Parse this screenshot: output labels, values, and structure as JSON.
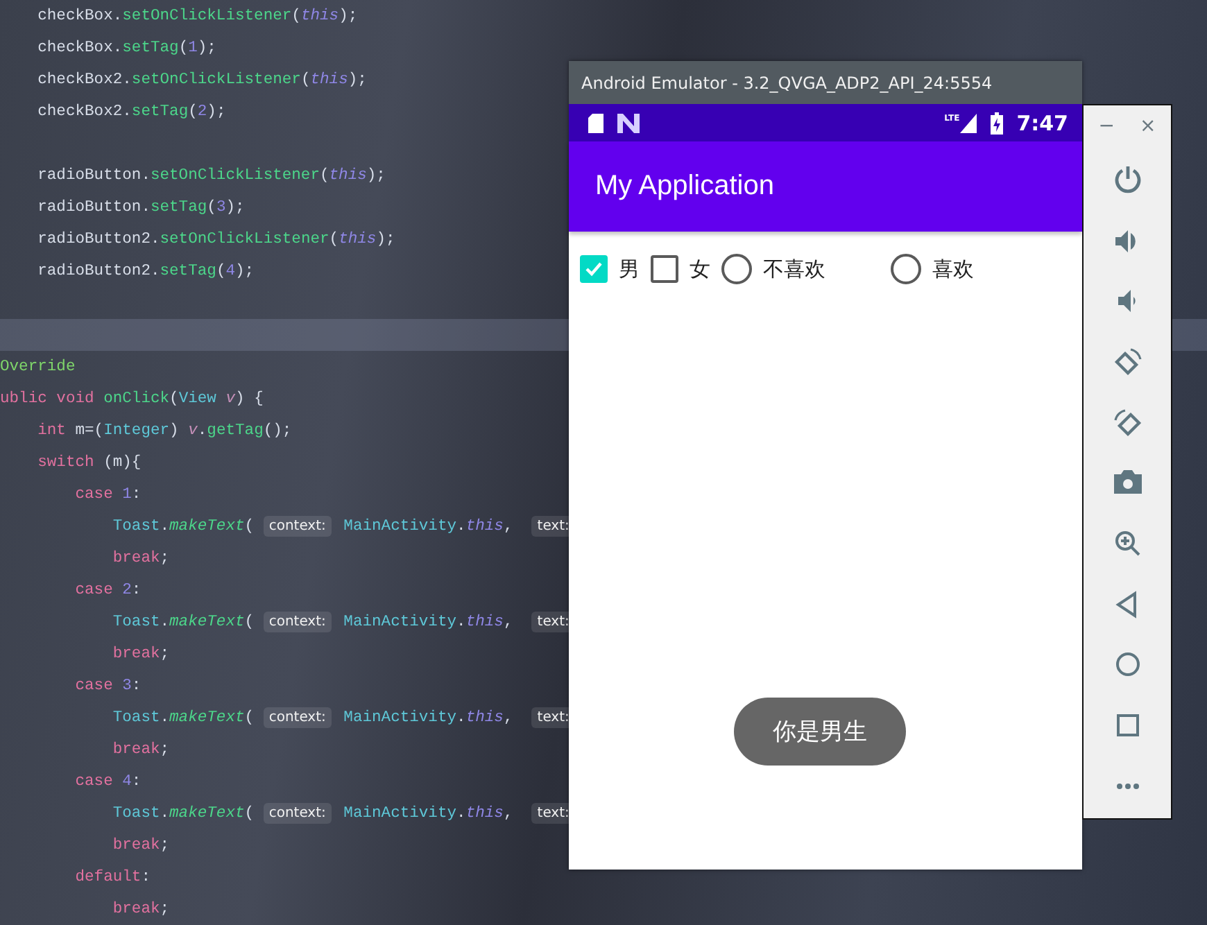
{
  "editor": {
    "lines": [
      {
        "current": false,
        "tokens": [
          {
            "kind": "plain",
            "t": "    checkBox."
          },
          {
            "kind": "method",
            "t": "setOnClickListener"
          },
          {
            "kind": "plain",
            "t": "("
          },
          {
            "kind": "self",
            "t": "this"
          },
          {
            "kind": "plain",
            "t": ");"
          }
        ]
      },
      {
        "current": false,
        "tokens": [
          {
            "kind": "plain",
            "t": "    checkBox."
          },
          {
            "kind": "method",
            "t": "setTag"
          },
          {
            "kind": "plain",
            "t": "("
          },
          {
            "kind": "number",
            "t": "1"
          },
          {
            "kind": "plain",
            "t": ");"
          }
        ]
      },
      {
        "current": false,
        "tokens": [
          {
            "kind": "plain",
            "t": "    checkBox2."
          },
          {
            "kind": "method",
            "t": "setOnClickListener"
          },
          {
            "kind": "plain",
            "t": "("
          },
          {
            "kind": "self",
            "t": "this"
          },
          {
            "kind": "plain",
            "t": ");"
          }
        ]
      },
      {
        "current": false,
        "tokens": [
          {
            "kind": "plain",
            "t": "    checkBox2."
          },
          {
            "kind": "method",
            "t": "setTag"
          },
          {
            "kind": "plain",
            "t": "("
          },
          {
            "kind": "number",
            "t": "2"
          },
          {
            "kind": "plain",
            "t": ");"
          }
        ]
      },
      {
        "current": false
      },
      {
        "current": false,
        "tokens": [
          {
            "kind": "plain",
            "t": "    radioButton."
          },
          {
            "kind": "method",
            "t": "setOnClickListener"
          },
          {
            "kind": "plain",
            "t": "("
          },
          {
            "kind": "self",
            "t": "this"
          },
          {
            "kind": "plain",
            "t": ");"
          }
        ]
      },
      {
        "current": false,
        "tokens": [
          {
            "kind": "plain",
            "t": "    radioButton."
          },
          {
            "kind": "method",
            "t": "setTag"
          },
          {
            "kind": "plain",
            "t": "("
          },
          {
            "kind": "number",
            "t": "3"
          },
          {
            "kind": "plain",
            "t": ");"
          }
        ]
      },
      {
        "current": false,
        "tokens": [
          {
            "kind": "plain",
            "t": "    radioButton2."
          },
          {
            "kind": "method",
            "t": "setOnClickListener"
          },
          {
            "kind": "plain",
            "t": "("
          },
          {
            "kind": "self",
            "t": "this"
          },
          {
            "kind": "plain",
            "t": ");"
          }
        ]
      },
      {
        "current": false,
        "tokens": [
          {
            "kind": "plain",
            "t": "    radioButton2."
          },
          {
            "kind": "method",
            "t": "setTag"
          },
          {
            "kind": "plain",
            "t": "("
          },
          {
            "kind": "number",
            "t": "4"
          },
          {
            "kind": "plain",
            "t": ");"
          }
        ]
      },
      {
        "current": false
      },
      {
        "current": true
      },
      {
        "current": false,
        "tokens": [
          {
            "kind": "annotation",
            "t": "Override"
          }
        ]
      },
      {
        "current": false,
        "tokens": [
          {
            "kind": "keyword",
            "t": "ublic void "
          },
          {
            "kind": "method",
            "t": "onClick"
          },
          {
            "kind": "plain",
            "t": "("
          },
          {
            "kind": "type",
            "t": "View "
          },
          {
            "kind": "param",
            "t": "v"
          },
          {
            "kind": "plain",
            "t": ") {"
          }
        ]
      },
      {
        "current": false,
        "tokens": [
          {
            "kind": "keyword",
            "t": "    int "
          },
          {
            "kind": "plain",
            "t": "m=("
          },
          {
            "kind": "type",
            "t": "Integer"
          },
          {
            "kind": "plain",
            "t": ") "
          },
          {
            "kind": "param",
            "t": "v"
          },
          {
            "kind": "plain",
            "t": "."
          },
          {
            "kind": "method",
            "t": "getTag"
          },
          {
            "kind": "plain",
            "t": "();"
          }
        ]
      },
      {
        "current": false,
        "tokens": [
          {
            "kind": "keyword",
            "t": "    switch "
          },
          {
            "kind": "plain",
            "t": "(m){"
          }
        ]
      },
      {
        "current": false,
        "tokens": [
          {
            "kind": "keyword",
            "t": "        case "
          },
          {
            "kind": "number",
            "t": "1"
          },
          {
            "kind": "plain",
            "t": ":"
          }
        ]
      },
      {
        "current": false,
        "tokens": [
          {
            "kind": "type",
            "t": "            Toast"
          },
          {
            "kind": "plain",
            "t": "."
          },
          {
            "kind": "static",
            "t": "makeText"
          },
          {
            "kind": "plain",
            "t": "( "
          },
          {
            "kind": "hint",
            "t": "context:"
          },
          {
            "kind": "type",
            "t": " MainActivity"
          },
          {
            "kind": "plain",
            "t": "."
          },
          {
            "kind": "self",
            "t": "this"
          },
          {
            "kind": "plain",
            "t": ",  "
          },
          {
            "kind": "hint",
            "t": "text:"
          }
        ]
      },
      {
        "current": false,
        "tokens": [
          {
            "kind": "keyword",
            "t": "            break"
          },
          {
            "kind": "plain",
            "t": ";"
          }
        ]
      },
      {
        "current": false,
        "tokens": [
          {
            "kind": "keyword",
            "t": "        case "
          },
          {
            "kind": "number",
            "t": "2"
          },
          {
            "kind": "plain",
            "t": ":"
          }
        ]
      },
      {
        "current": false,
        "tokens": [
          {
            "kind": "type",
            "t": "            Toast"
          },
          {
            "kind": "plain",
            "t": "."
          },
          {
            "kind": "static",
            "t": "makeText"
          },
          {
            "kind": "plain",
            "t": "( "
          },
          {
            "kind": "hint",
            "t": "context:"
          },
          {
            "kind": "type",
            "t": " MainActivity"
          },
          {
            "kind": "plain",
            "t": "."
          },
          {
            "kind": "self",
            "t": "this"
          },
          {
            "kind": "plain",
            "t": ",  "
          },
          {
            "kind": "hint",
            "t": "text:"
          }
        ]
      },
      {
        "current": false,
        "tokens": [
          {
            "kind": "keyword",
            "t": "            break"
          },
          {
            "kind": "plain",
            "t": ";"
          }
        ]
      },
      {
        "current": false,
        "tokens": [
          {
            "kind": "keyword",
            "t": "        case "
          },
          {
            "kind": "number",
            "t": "3"
          },
          {
            "kind": "plain",
            "t": ":"
          }
        ]
      },
      {
        "current": false,
        "tokens": [
          {
            "kind": "type",
            "t": "            Toast"
          },
          {
            "kind": "plain",
            "t": "."
          },
          {
            "kind": "static",
            "t": "makeText"
          },
          {
            "kind": "plain",
            "t": "( "
          },
          {
            "kind": "hint",
            "t": "context:"
          },
          {
            "kind": "type",
            "t": " MainActivity"
          },
          {
            "kind": "plain",
            "t": "."
          },
          {
            "kind": "self",
            "t": "this"
          },
          {
            "kind": "plain",
            "t": ",  "
          },
          {
            "kind": "hint",
            "t": "text:"
          }
        ]
      },
      {
        "current": false,
        "tokens": [
          {
            "kind": "keyword",
            "t": "            break"
          },
          {
            "kind": "plain",
            "t": ";"
          }
        ]
      },
      {
        "current": false,
        "tokens": [
          {
            "kind": "keyword",
            "t": "        case "
          },
          {
            "kind": "number",
            "t": "4"
          },
          {
            "kind": "plain",
            "t": ":"
          }
        ]
      },
      {
        "current": false,
        "tokens": [
          {
            "kind": "type",
            "t": "            Toast"
          },
          {
            "kind": "plain",
            "t": "."
          },
          {
            "kind": "static",
            "t": "makeText"
          },
          {
            "kind": "plain",
            "t": "( "
          },
          {
            "kind": "hint",
            "t": "context:"
          },
          {
            "kind": "type",
            "t": " MainActivity"
          },
          {
            "kind": "plain",
            "t": "."
          },
          {
            "kind": "self",
            "t": "this"
          },
          {
            "kind": "plain",
            "t": ",  "
          },
          {
            "kind": "hint",
            "t": "text:"
          }
        ]
      },
      {
        "current": false,
        "tokens": [
          {
            "kind": "keyword",
            "t": "            break"
          },
          {
            "kind": "plain",
            "t": ";"
          }
        ]
      },
      {
        "current": false,
        "tokens": [
          {
            "kind": "keyword",
            "t": "        default"
          },
          {
            "kind": "plain",
            "t": ":"
          }
        ]
      },
      {
        "current": false,
        "tokens": [
          {
            "kind": "keyword",
            "t": "            break"
          },
          {
            "kind": "plain",
            "t": ";"
          }
        ]
      }
    ]
  },
  "emulator": {
    "title": "Android Emulator - 3.2_QVGA_ADP2_API_24:5554",
    "status_bar": {
      "network_label": "LTE",
      "time": "7:47"
    },
    "app_bar": {
      "title": "My Application"
    },
    "options": [
      {
        "kind": "checkbox",
        "label": "男",
        "checked": true
      },
      {
        "kind": "checkbox",
        "label": "女",
        "checked": false
      },
      {
        "kind": "radio",
        "label": "不喜欢",
        "checked": false
      },
      {
        "kind": "radio",
        "label": "喜欢",
        "checked": false
      }
    ],
    "toast": "你是男生",
    "side_panel": {
      "minimize": "−",
      "close": "×"
    }
  }
}
